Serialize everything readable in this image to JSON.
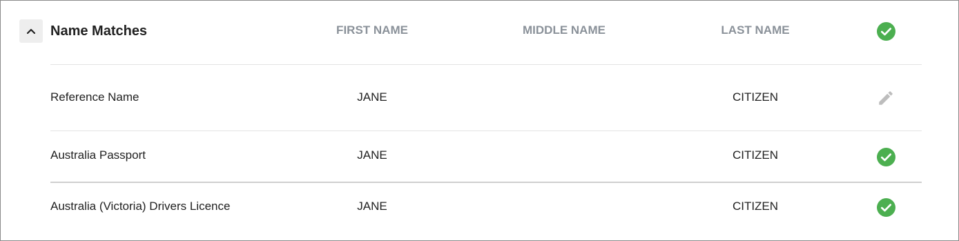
{
  "section": {
    "title": "Name Matches",
    "expanded": true
  },
  "columns": {
    "first_name": "FIRST NAME",
    "middle_name": "MIDDLE NAME",
    "last_name": "LAST NAME"
  },
  "header_status": "check-circle-icon",
  "rows": [
    {
      "source": "Reference Name",
      "first_name": "JANE",
      "middle_name": "",
      "last_name": "CITIZEN",
      "status": "edit-icon"
    },
    {
      "source": "Australia Passport",
      "first_name": "JANE",
      "middle_name": "",
      "last_name": "CITIZEN",
      "status": "check-circle-icon"
    },
    {
      "source": "Australia (Victoria) Drivers Licence",
      "first_name": "JANE",
      "middle_name": "",
      "last_name": "CITIZEN",
      "status": "check-circle-icon"
    }
  ],
  "colors": {
    "check_green": "#4caf50",
    "edit_grey": "#bdbdbd",
    "header_text": "#8a9199"
  }
}
